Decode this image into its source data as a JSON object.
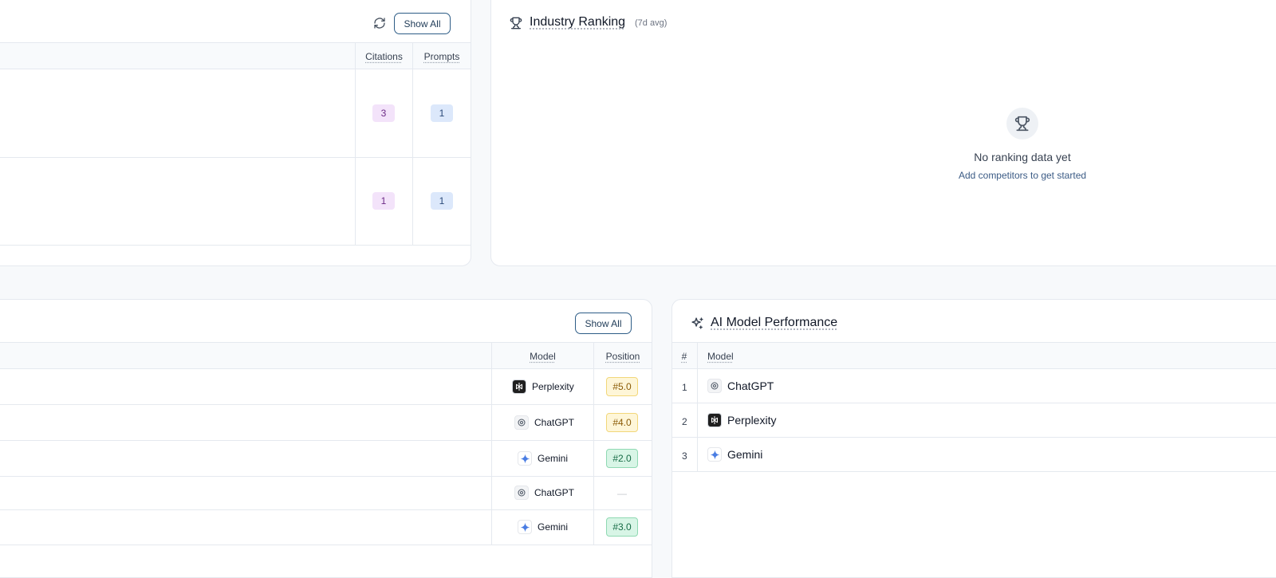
{
  "top_table": {
    "show_all_label": "Show All",
    "columns": [
      "Citations",
      "Prompts"
    ],
    "rows": [
      {
        "citations": "3",
        "prompts": "1"
      },
      {
        "citations": "1",
        "prompts": "1"
      }
    ]
  },
  "industry_ranking": {
    "title": "Industry Ranking",
    "subtitle": "(7d avg)",
    "empty_title": "No ranking data yet",
    "empty_hint": "Add competitors to get started"
  },
  "responses_table": {
    "show_all_label": "Show All",
    "columns": [
      "Model",
      "Position"
    ],
    "rows": [
      {
        "model": "Perplexity",
        "icon": "perplexity-icon",
        "position": "#5.0",
        "tone": "yellow"
      },
      {
        "model": "ChatGPT",
        "icon": "chatgpt-icon",
        "position": "#4.0",
        "tone": "yellow"
      },
      {
        "model": "Gemini",
        "icon": "gemini-icon",
        "position": "#2.0",
        "tone": "green"
      },
      {
        "model": "ChatGPT",
        "icon": "chatgpt-icon",
        "position": "—",
        "tone": "none"
      },
      {
        "model": "Gemini",
        "icon": "gemini-icon",
        "position": "#3.0",
        "tone": "green"
      }
    ]
  },
  "ai_model_performance": {
    "title": "AI Model Performance",
    "columns": [
      "#",
      "Model"
    ],
    "rows": [
      {
        "rank": "1",
        "model": "ChatGPT",
        "icon": "chatgpt-icon"
      },
      {
        "rank": "2",
        "model": "Perplexity",
        "icon": "perplexity-icon"
      },
      {
        "rank": "3",
        "model": "Gemini",
        "icon": "gemini-icon"
      }
    ]
  },
  "colors": {
    "accent_border": "#2d5c86",
    "citations_pill": "#f3e3fa",
    "prompts_pill": "#dce8fb",
    "position_yellow": "#fef6d8",
    "position_green": "#d8f5e6"
  }
}
